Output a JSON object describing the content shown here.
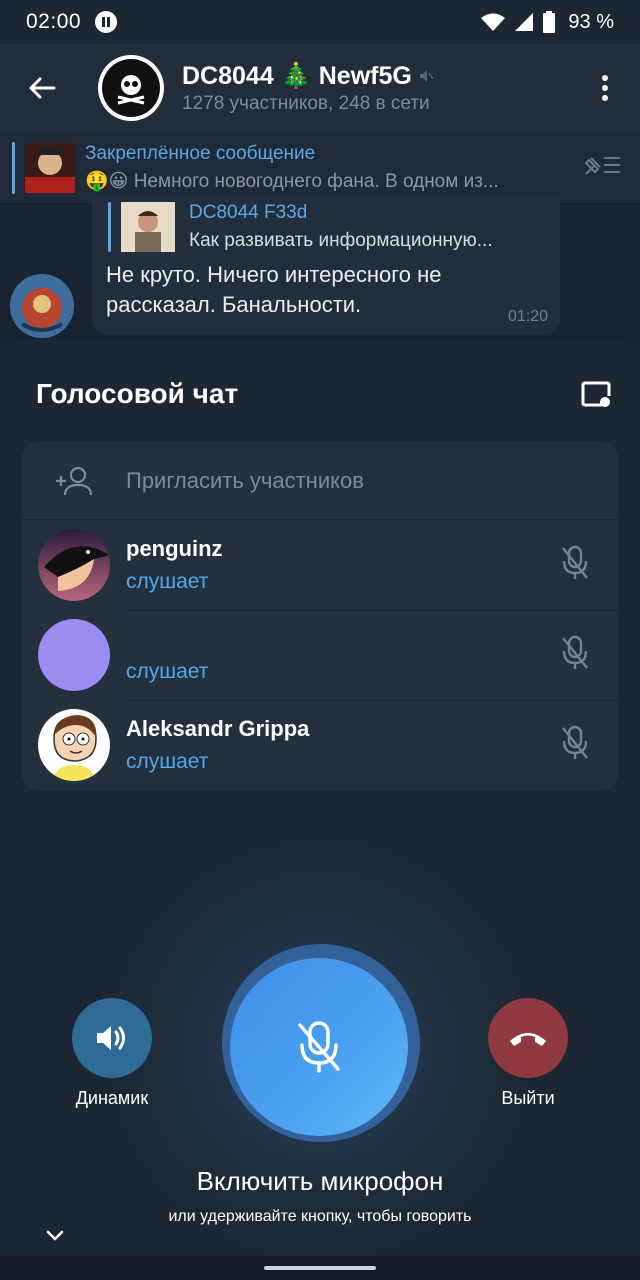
{
  "status_bar": {
    "time": "02:00",
    "battery": "93 %"
  },
  "chat": {
    "title": "DC8044 🎄 Newf5G",
    "subtitle": "1278 участников, 248 в сети",
    "pinned": {
      "title": "Закреплённое сообщение",
      "text": "🤑😀 Немного новогоднего фана. В одном из..."
    },
    "message": {
      "reply_author": "DC8044 F33d",
      "reply_text": "Как развивать информационную...",
      "text": "Не круто. Ничего интересного не рассказал. Банальности.",
      "time": "01:20"
    }
  },
  "voice_chat": {
    "title": "Голосовой чат",
    "invite_label": "Пригласить участников",
    "participants": [
      {
        "name": "penguinz",
        "status": "слушает",
        "avatar_color": "#6a3d82"
      },
      {
        "name": "",
        "status": "слушает",
        "avatar_color": "#9a8cf0"
      },
      {
        "name": "Aleksandr Grippa",
        "status": "слушает",
        "avatar_color": "#ffffff"
      }
    ],
    "speaker_label": "Динамик",
    "leave_label": "Выйти",
    "mic_main_text": "Включить микрофон",
    "mic_hint_text": "или удерживайте кнопку, чтобы говорить"
  },
  "colors": {
    "accent": "#4fa9ec",
    "background": "#1c2733",
    "card": "#24303d",
    "leave": "#8e3a3e",
    "speaker": "#2f6b94"
  }
}
